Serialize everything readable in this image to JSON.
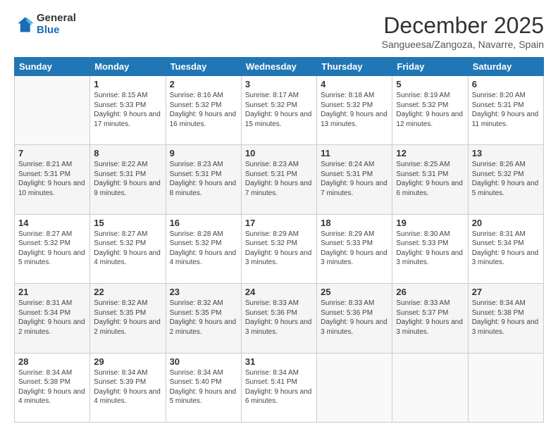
{
  "logo": {
    "general": "General",
    "blue": "Blue"
  },
  "header": {
    "month": "December 2025",
    "location": "Sangueesa/Zangoza, Navarre, Spain"
  },
  "weekdays": [
    "Sunday",
    "Monday",
    "Tuesday",
    "Wednesday",
    "Thursday",
    "Friday",
    "Saturday"
  ],
  "weeks": [
    [
      {
        "day": "",
        "empty": true
      },
      {
        "day": "1",
        "rise": "Sunrise: 8:15 AM",
        "set": "Sunset: 5:33 PM",
        "daylight": "Daylight: 9 hours and 17 minutes."
      },
      {
        "day": "2",
        "rise": "Sunrise: 8:16 AM",
        "set": "Sunset: 5:32 PM",
        "daylight": "Daylight: 9 hours and 16 minutes."
      },
      {
        "day": "3",
        "rise": "Sunrise: 8:17 AM",
        "set": "Sunset: 5:32 PM",
        "daylight": "Daylight: 9 hours and 15 minutes."
      },
      {
        "day": "4",
        "rise": "Sunrise: 8:18 AM",
        "set": "Sunset: 5:32 PM",
        "daylight": "Daylight: 9 hours and 13 minutes."
      },
      {
        "day": "5",
        "rise": "Sunrise: 8:19 AM",
        "set": "Sunset: 5:32 PM",
        "daylight": "Daylight: 9 hours and 12 minutes."
      },
      {
        "day": "6",
        "rise": "Sunrise: 8:20 AM",
        "set": "Sunset: 5:31 PM",
        "daylight": "Daylight: 9 hours and 11 minutes."
      }
    ],
    [
      {
        "day": "7",
        "rise": "Sunrise: 8:21 AM",
        "set": "Sunset: 5:31 PM",
        "daylight": "Daylight: 9 hours and 10 minutes."
      },
      {
        "day": "8",
        "rise": "Sunrise: 8:22 AM",
        "set": "Sunset: 5:31 PM",
        "daylight": "Daylight: 9 hours and 9 minutes."
      },
      {
        "day": "9",
        "rise": "Sunrise: 8:23 AM",
        "set": "Sunset: 5:31 PM",
        "daylight": "Daylight: 9 hours and 8 minutes."
      },
      {
        "day": "10",
        "rise": "Sunrise: 8:23 AM",
        "set": "Sunset: 5:31 PM",
        "daylight": "Daylight: 9 hours and 7 minutes."
      },
      {
        "day": "11",
        "rise": "Sunrise: 8:24 AM",
        "set": "Sunset: 5:31 PM",
        "daylight": "Daylight: 9 hours and 7 minutes."
      },
      {
        "day": "12",
        "rise": "Sunrise: 8:25 AM",
        "set": "Sunset: 5:31 PM",
        "daylight": "Daylight: 9 hours and 6 minutes."
      },
      {
        "day": "13",
        "rise": "Sunrise: 8:26 AM",
        "set": "Sunset: 5:32 PM",
        "daylight": "Daylight: 9 hours and 5 minutes."
      }
    ],
    [
      {
        "day": "14",
        "rise": "Sunrise: 8:27 AM",
        "set": "Sunset: 5:32 PM",
        "daylight": "Daylight: 9 hours and 5 minutes."
      },
      {
        "day": "15",
        "rise": "Sunrise: 8:27 AM",
        "set": "Sunset: 5:32 PM",
        "daylight": "Daylight: 9 hours and 4 minutes."
      },
      {
        "day": "16",
        "rise": "Sunrise: 8:28 AM",
        "set": "Sunset: 5:32 PM",
        "daylight": "Daylight: 9 hours and 4 minutes."
      },
      {
        "day": "17",
        "rise": "Sunrise: 8:29 AM",
        "set": "Sunset: 5:32 PM",
        "daylight": "Daylight: 9 hours and 3 minutes."
      },
      {
        "day": "18",
        "rise": "Sunrise: 8:29 AM",
        "set": "Sunset: 5:33 PM",
        "daylight": "Daylight: 9 hours and 3 minutes."
      },
      {
        "day": "19",
        "rise": "Sunrise: 8:30 AM",
        "set": "Sunset: 5:33 PM",
        "daylight": "Daylight: 9 hours and 3 minutes."
      },
      {
        "day": "20",
        "rise": "Sunrise: 8:31 AM",
        "set": "Sunset: 5:34 PM",
        "daylight": "Daylight: 9 hours and 3 minutes."
      }
    ],
    [
      {
        "day": "21",
        "rise": "Sunrise: 8:31 AM",
        "set": "Sunset: 5:34 PM",
        "daylight": "Daylight: 9 hours and 2 minutes."
      },
      {
        "day": "22",
        "rise": "Sunrise: 8:32 AM",
        "set": "Sunset: 5:35 PM",
        "daylight": "Daylight: 9 hours and 2 minutes."
      },
      {
        "day": "23",
        "rise": "Sunrise: 8:32 AM",
        "set": "Sunset: 5:35 PM",
        "daylight": "Daylight: 9 hours and 2 minutes."
      },
      {
        "day": "24",
        "rise": "Sunrise: 8:33 AM",
        "set": "Sunset: 5:36 PM",
        "daylight": "Daylight: 9 hours and 3 minutes."
      },
      {
        "day": "25",
        "rise": "Sunrise: 8:33 AM",
        "set": "Sunset: 5:36 PM",
        "daylight": "Daylight: 9 hours and 3 minutes."
      },
      {
        "day": "26",
        "rise": "Sunrise: 8:33 AM",
        "set": "Sunset: 5:37 PM",
        "daylight": "Daylight: 9 hours and 3 minutes."
      },
      {
        "day": "27",
        "rise": "Sunrise: 8:34 AM",
        "set": "Sunset: 5:38 PM",
        "daylight": "Daylight: 9 hours and 3 minutes."
      }
    ],
    [
      {
        "day": "28",
        "rise": "Sunrise: 8:34 AM",
        "set": "Sunset: 5:38 PM",
        "daylight": "Daylight: 9 hours and 4 minutes."
      },
      {
        "day": "29",
        "rise": "Sunrise: 8:34 AM",
        "set": "Sunset: 5:39 PM",
        "daylight": "Daylight: 9 hours and 4 minutes."
      },
      {
        "day": "30",
        "rise": "Sunrise: 8:34 AM",
        "set": "Sunset: 5:40 PM",
        "daylight": "Daylight: 9 hours and 5 minutes."
      },
      {
        "day": "31",
        "rise": "Sunrise: 8:34 AM",
        "set": "Sunset: 5:41 PM",
        "daylight": "Daylight: 9 hours and 6 minutes."
      },
      {
        "day": "",
        "empty": true
      },
      {
        "day": "",
        "empty": true
      },
      {
        "day": "",
        "empty": true
      }
    ]
  ]
}
